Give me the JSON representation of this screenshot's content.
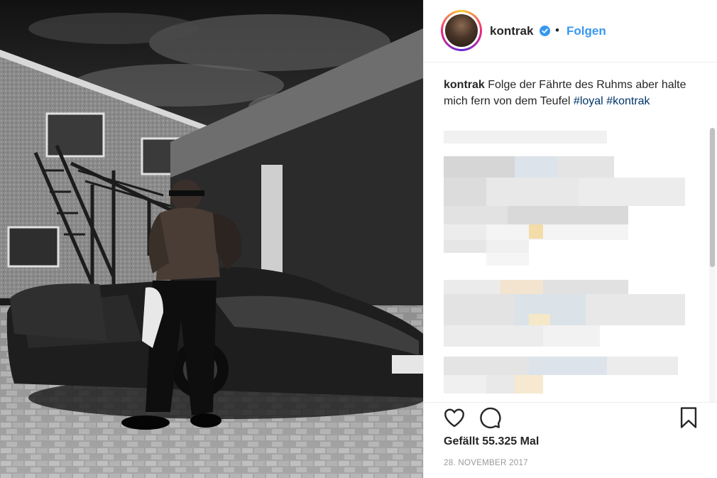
{
  "post": {
    "username": "kontrak",
    "follow_label": "Folgen",
    "separator": "•"
  },
  "caption": {
    "user": "kontrak",
    "text": "Folge der Fährte des Ruhms aber halte mich fern von dem Teufel",
    "tag_loyal": "#loyal",
    "tag_kontrak": "#kontrak"
  },
  "footer": {
    "likes": "Gefällt 55.325 Mal",
    "date": "28. NOVEMBER 2017"
  },
  "icons": {
    "verified": "verified-badge-icon",
    "like": "heart-icon",
    "comment": "comment-bubble-icon",
    "save": "bookmark-icon"
  },
  "colors": {
    "link": "#3897f0",
    "hashtag": "#003569",
    "verified": "#3897f0",
    "muted": "#999999"
  }
}
